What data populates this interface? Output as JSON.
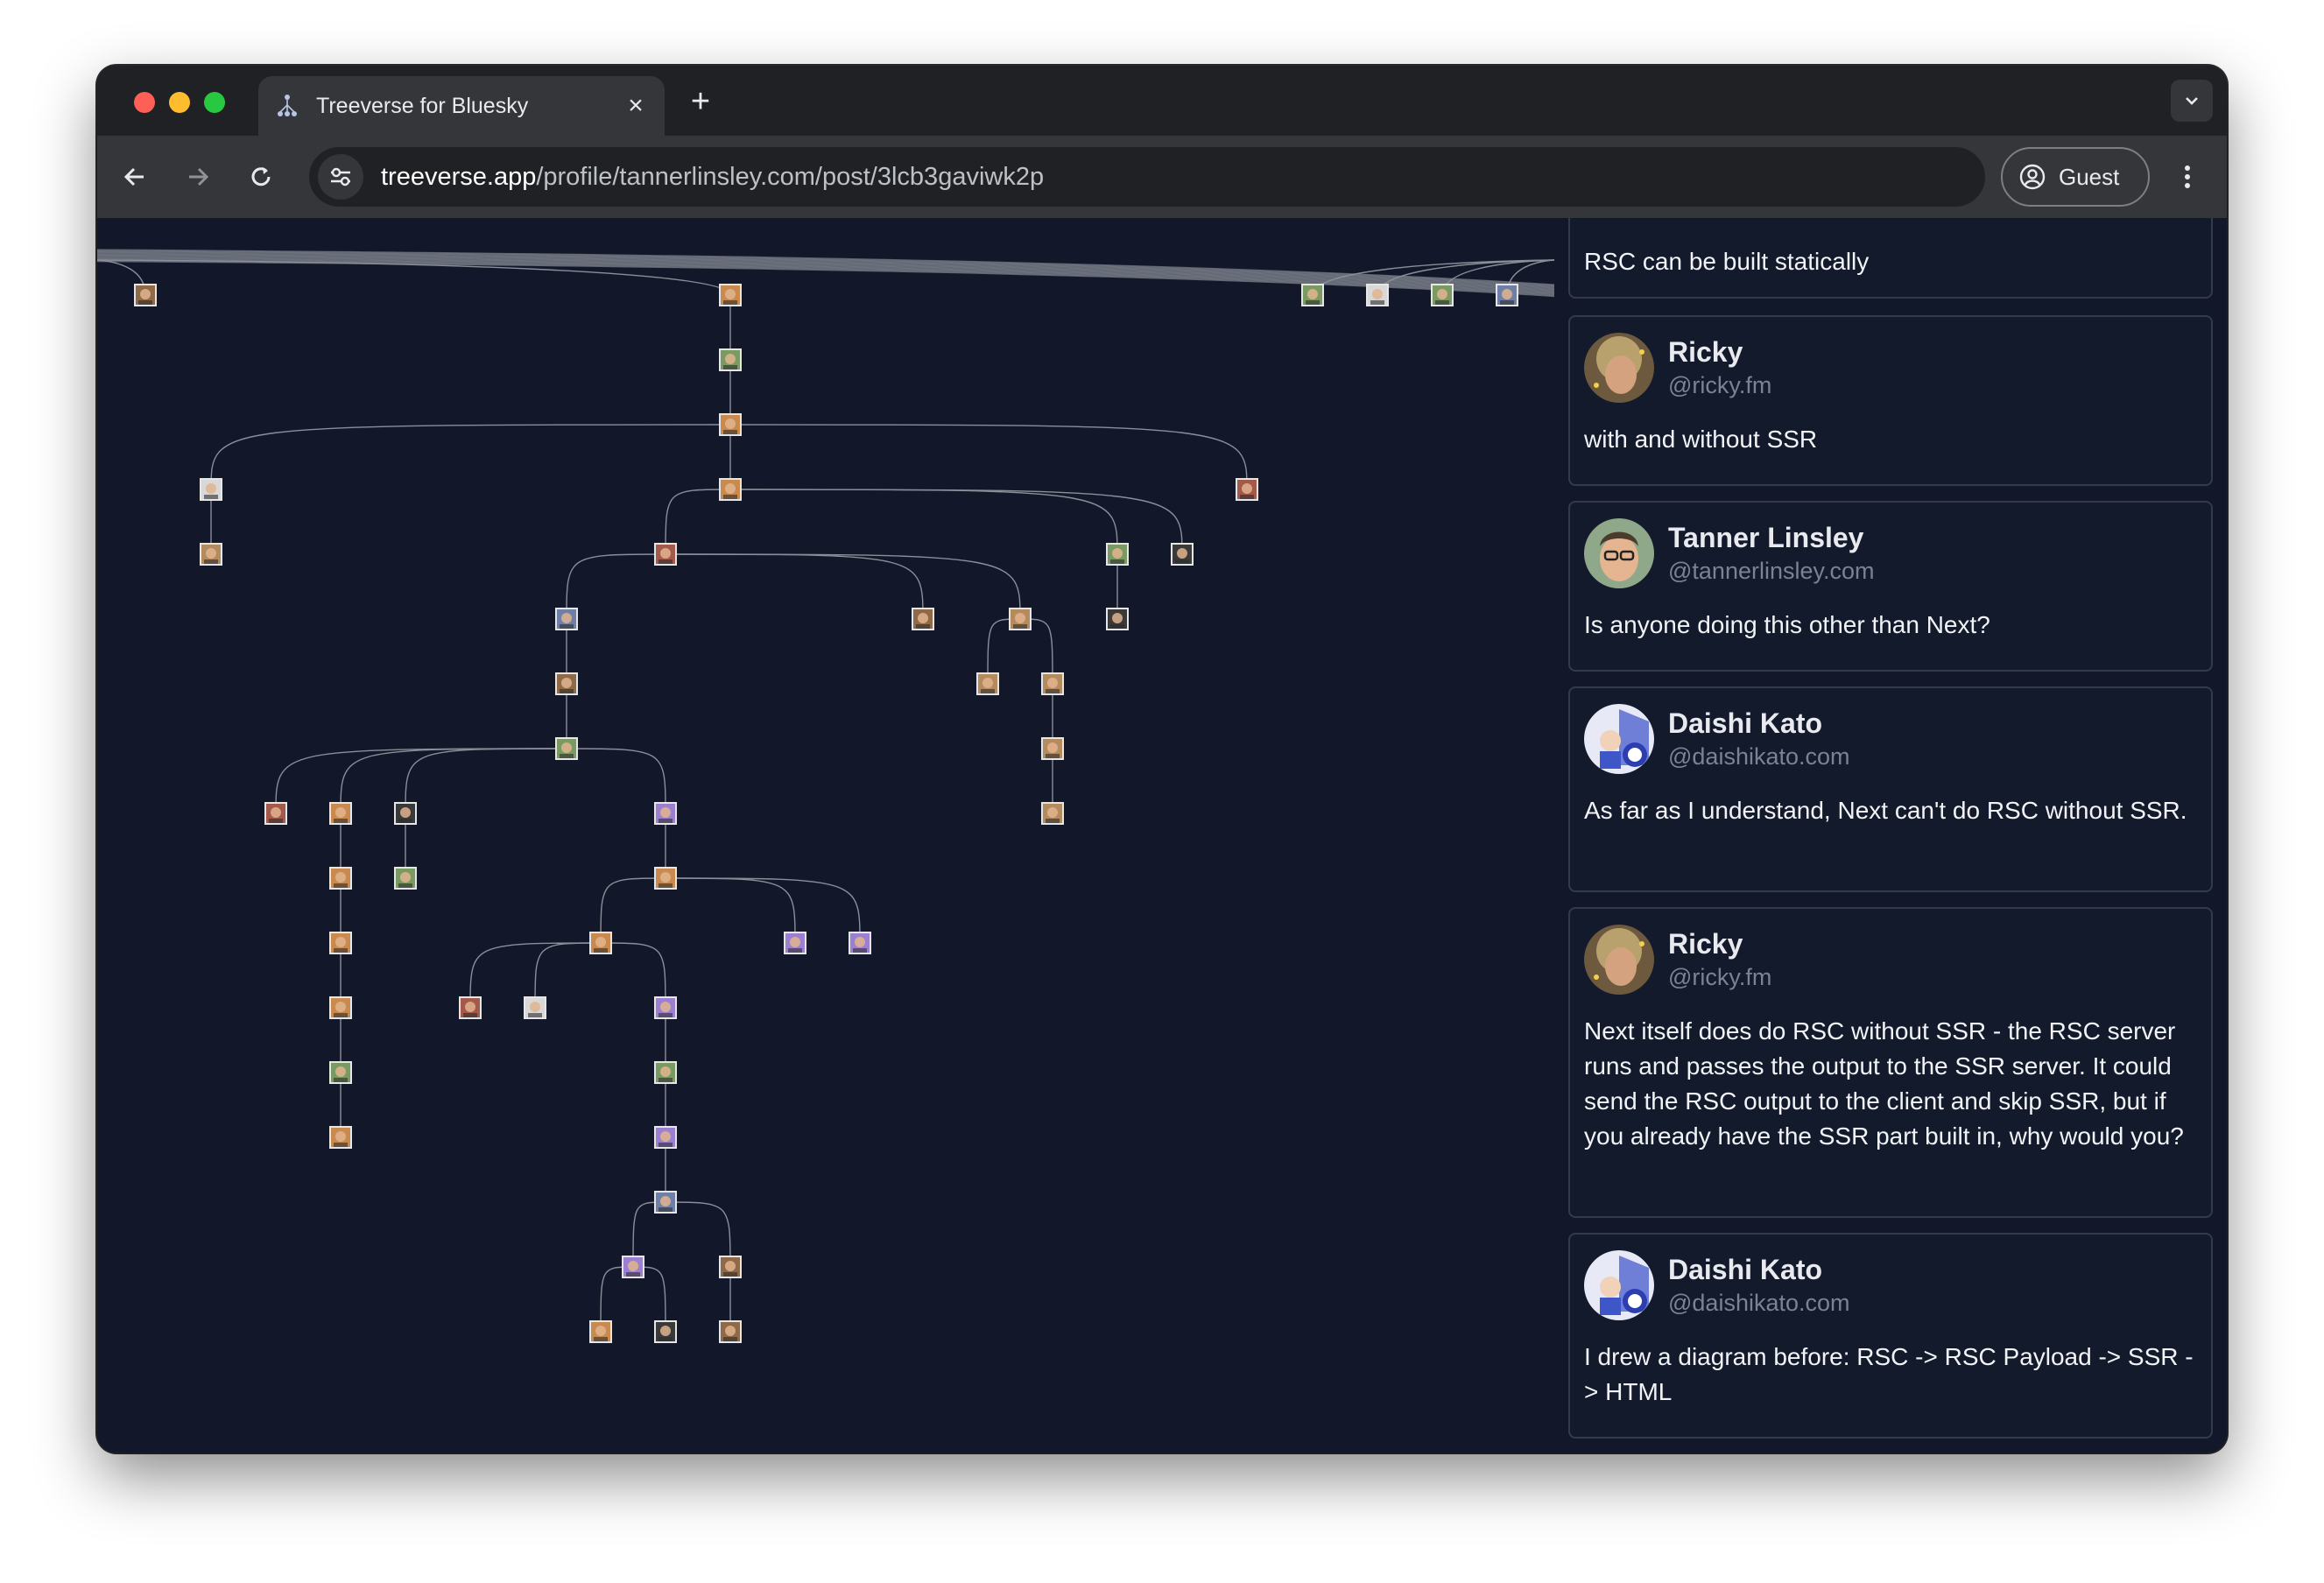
{
  "browser": {
    "tab_title": "Treeverse for Bluesky",
    "url_host": "treeverse.app",
    "url_path": "/profile/tannerlinsley.com/post/3lcb3gaviwk2p",
    "profile_label": "Guest"
  },
  "thread": {
    "partial_post_text": "RSC can be built statically",
    "posts": [
      {
        "display_name": "Ricky",
        "handle": "@ricky.fm",
        "text": "with and without SSR",
        "avatar_icon": "ricky-avatar"
      },
      {
        "display_name": "Tanner Linsley",
        "handle": "@tannerlinsley.com",
        "text": "Is anyone doing this other than Next?",
        "avatar_icon": "tanner-avatar"
      },
      {
        "display_name": "Daishi Kato",
        "handle": "@daishikato.com",
        "text": "As far as I understand, Next can't do RSC without SSR.",
        "avatar_icon": "daishi-avatar"
      },
      {
        "display_name": "Ricky",
        "handle": "@ricky.fm",
        "text": "Next itself does do RSC without SSR - the RSC server runs and passes the output to the SSR server. It could send the RSC output to the client and skip SSR, but if you already have the SSR part built in, why would you?",
        "avatar_icon": "ricky-avatar"
      },
      {
        "display_name": "Daishi Kato",
        "handle": "@daishikato.com",
        "text": "I drew a diagram before: RSC -> RSC Payload -> SSR -> HTML",
        "avatar_icon": "daishi-avatar"
      }
    ]
  },
  "colors": {
    "canvas_bg": "#121829",
    "edge": "#8a8f99",
    "card_border": "#323a4d",
    "avatar_palette": [
      "#c98a4f",
      "#8f6a48",
      "#b48b5e",
      "#6e7fa8",
      "#7a9a63",
      "#d8d8d8",
      "#3a3a3a",
      "#a35a4a",
      "#9b7fd1"
    ]
  }
}
